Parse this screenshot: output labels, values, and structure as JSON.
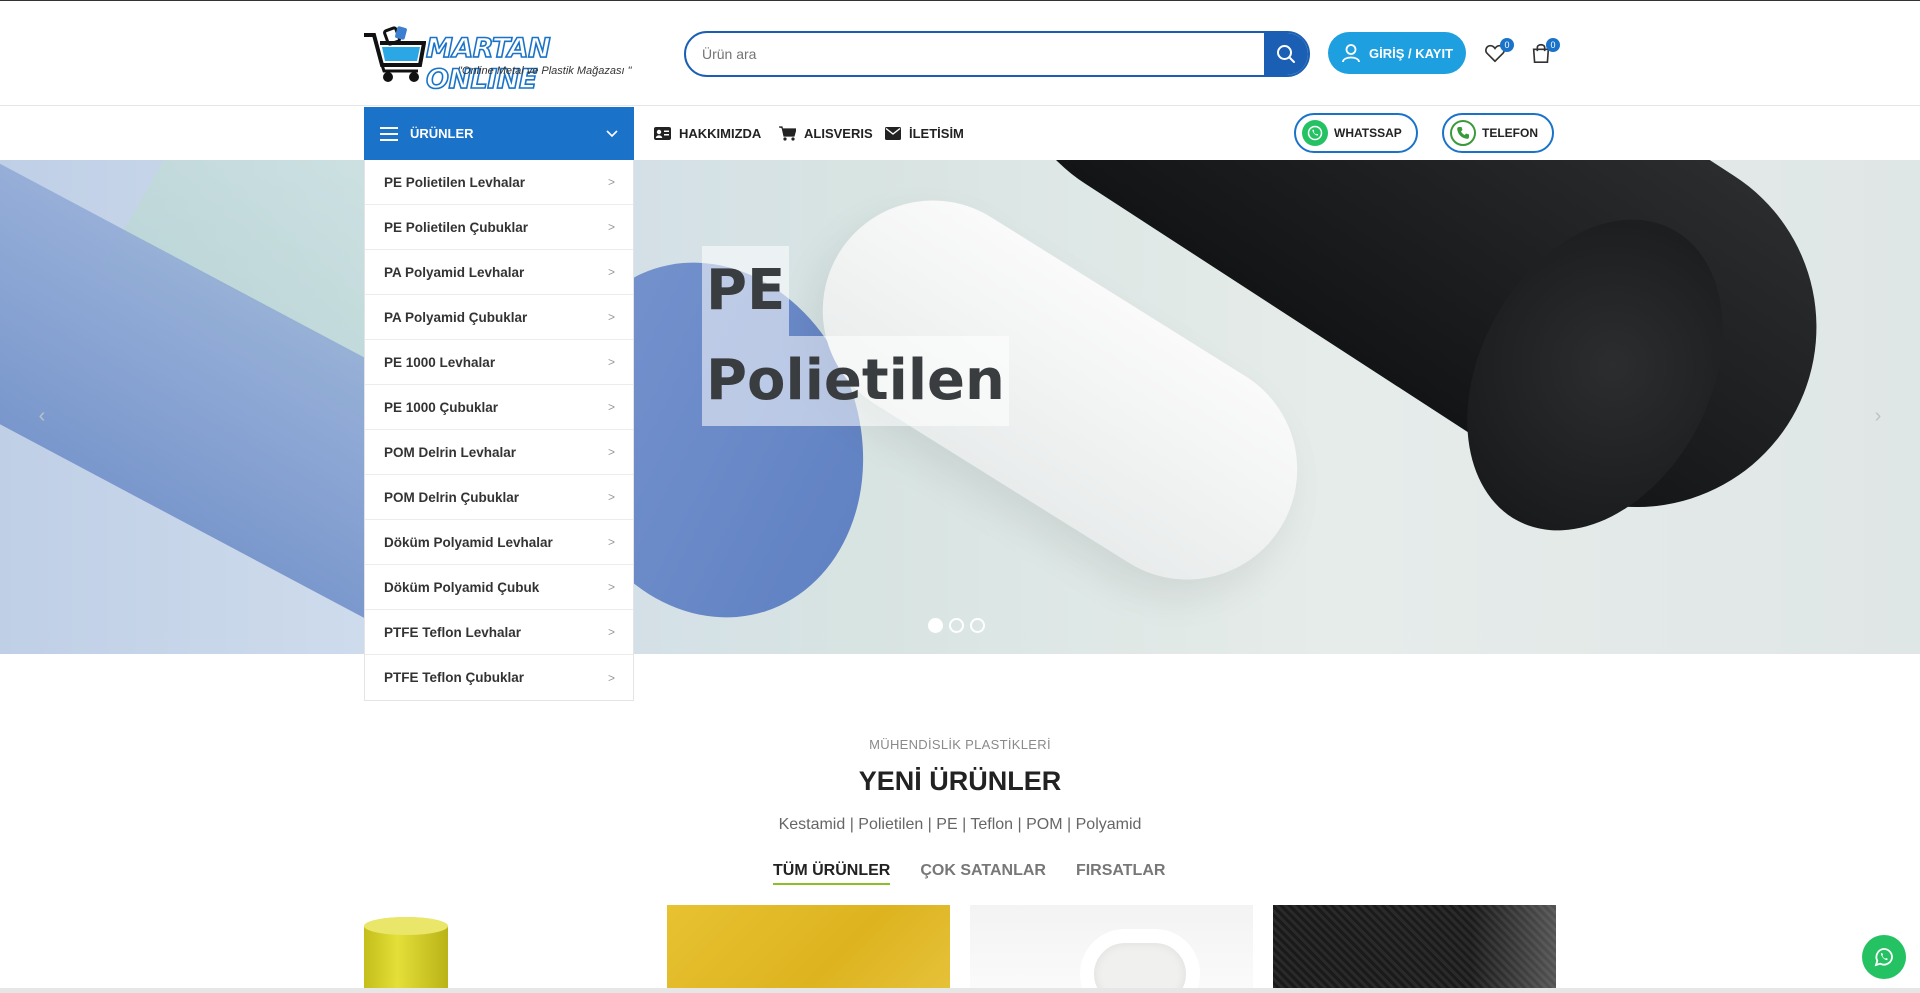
{
  "header": {
    "logo": {
      "name": "MARTAN ONLINE",
      "tagline": "\"Online Metal ve Plastik Mağazası \""
    },
    "search": {
      "placeholder": "Ürün ara"
    },
    "login_label": "GİRİŞ / KAYIT",
    "wishlist_count": "0",
    "cart_count": "0"
  },
  "nav": {
    "categories_label": "ÜRÜNLER",
    "links": [
      {
        "label": "HAKKIMIZDA",
        "icon": "id-card-icon"
      },
      {
        "label": "ALISVERIS",
        "icon": "cart-icon"
      },
      {
        "label": "İLETİSİM",
        "icon": "envelope-icon"
      }
    ],
    "whatsapp_label": "WHATSSAP",
    "phone_label": "TELEFON"
  },
  "categories": [
    "PE Polietilen Levhalar",
    "PE Polietilen Çubuklar",
    "PA Polyamid Levhalar",
    "PA Polyamid Çubuklar",
    "PE 1000 Levhalar",
    "PE 1000 Çubuklar",
    "POM Delrin Levhalar",
    "POM Delrin Çubuklar",
    "Döküm Polyamid Levhalar",
    "Döküm Polyamid Çubuk",
    "PTFE Teflon Levhalar",
    "PTFE Teflon Çubuklar"
  ],
  "hero": {
    "title_line1": "PE",
    "title_line2": "Polietilen",
    "prev_arrow": "‹",
    "next_arrow": "›",
    "slide_count": 3,
    "active_slide": 1
  },
  "section": {
    "subtitle": "MÜHENDİSLİK PLASTİKLERİ",
    "title": "YENİ ÜRÜNLER",
    "description": "Kestamid | Polietilen | PE | Teflon | POM | Polyamid",
    "tabs": [
      "TÜM ÜRÜNLER",
      "ÇOK SATANLAR",
      "FIRSATLAR"
    ],
    "active_tab": 0
  },
  "colors": {
    "brand_blue": "#1a73c9",
    "search_blue": "#1a5fb4",
    "login_blue": "#1ea0e0",
    "whatsapp_green": "#25c264",
    "tab_underline": "#8bbf2a"
  }
}
